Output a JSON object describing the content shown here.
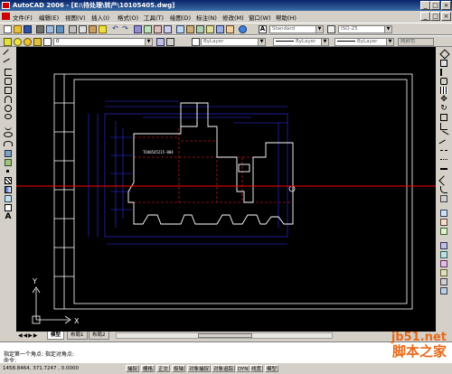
{
  "window": {
    "title": "AutoCAD 2006 - [E:\\待处理\\转产\\10105405.dwg]"
  },
  "menu": {
    "items": [
      "文件(F)",
      "编辑(E)",
      "视图(V)",
      "插入(I)",
      "格式(O)",
      "工具(T)",
      "绘图(D)",
      "标注(N)",
      "修改(M)",
      "窗口(W)",
      "帮助(H)"
    ]
  },
  "toolbar": {
    "text_style": "Standard",
    "dim_style": "ISO-25",
    "layer": "0",
    "color": "ByLayer",
    "linetype": "ByLayer",
    "lineweight": "ByLayer",
    "plotstyle": "随颜色"
  },
  "drawing": {
    "part_label": "TO40545215-004",
    "ucs_x": "X",
    "ucs_y": "Y"
  },
  "tabs": {
    "model": "模型",
    "layout1": "布局1",
    "layout2": "布局2"
  },
  "command": {
    "line1": "",
    "line2": "指定第一个角点: 指定对角点:",
    "line3": "命令:"
  },
  "status": {
    "coords": "1458.8464, 371.7247 , 0.0000",
    "buttons": [
      "捕捉",
      "栅格",
      "正交",
      "极轴",
      "对象捕捉",
      "对象追踪",
      "DYN",
      "线宽",
      "模型"
    ]
  },
  "watermark": {
    "line1": "jb51.net",
    "line2": "脚本之家"
  },
  "colors": {
    "canvas": "#000000",
    "crosshair": "#ff0000",
    "geometry": "#ffffff",
    "dimensions": "#3030ff",
    "fold_lines": "#ff2020"
  }
}
